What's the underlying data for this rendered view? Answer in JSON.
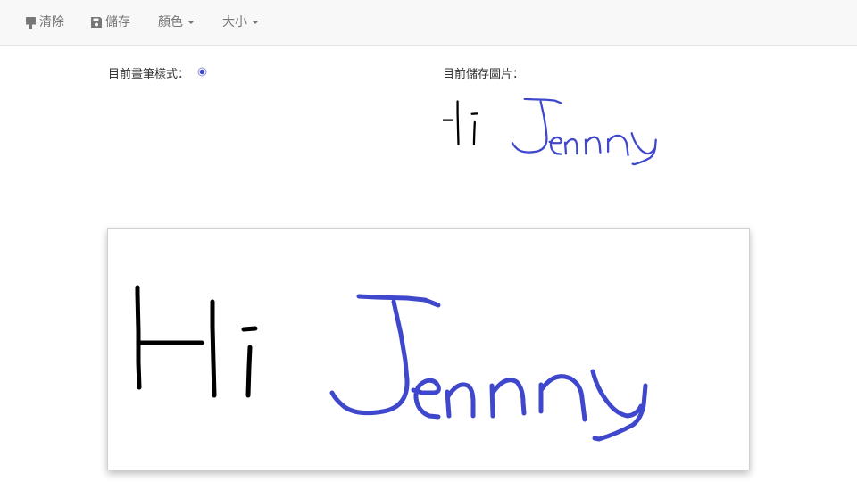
{
  "toolbar": {
    "clear_label": "清除",
    "save_label": "儲存",
    "color_label": "顏色",
    "size_label": "大小",
    "clear_icon": "brush-icon",
    "save_icon": "floppy-disk-icon"
  },
  "status": {
    "pen_style_label": "目前畫筆樣式：",
    "pen_color": "#3f48cc",
    "saved_image_label": "目前儲存圖片："
  },
  "drawing": {
    "handwriting_text": "Hi Jenny",
    "colors": {
      "hi": "#000000",
      "jenny": "#3f48cc"
    }
  }
}
